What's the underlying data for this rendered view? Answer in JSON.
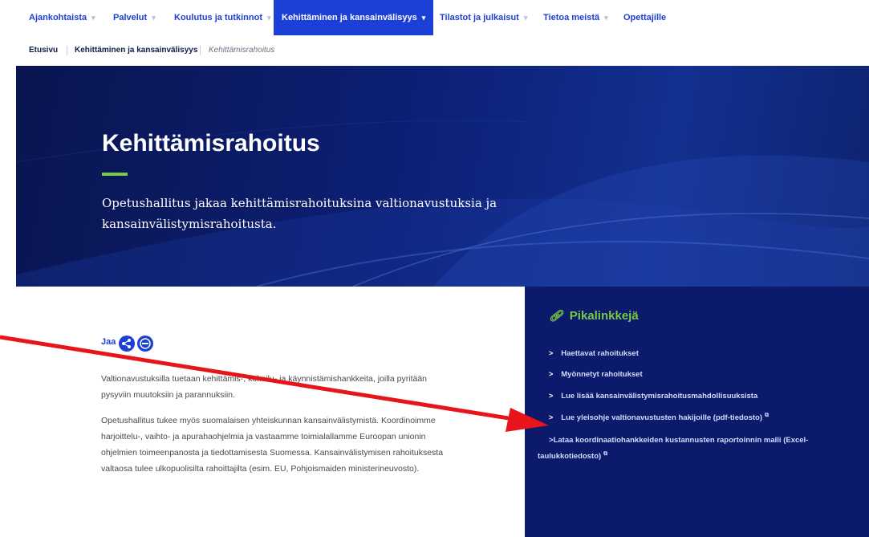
{
  "nav": {
    "items": [
      {
        "label": "Ajankohtaista"
      },
      {
        "label": "Palvelut"
      },
      {
        "label": "Koulutus ja tutkinnot"
      },
      {
        "label": "Kehittäminen ja kansainvälisyys",
        "active": true
      },
      {
        "label": "Tilastot ja julkaisut"
      },
      {
        "label": "Tietoa meistä"
      },
      {
        "label": "Opettajille"
      }
    ],
    "caret_icon": "chevron-down-icon"
  },
  "breadcrumb": {
    "items": [
      "Etusivu",
      "Kehittäminen ja kansainvälisyys",
      "Kehittämisrahoitus"
    ]
  },
  "hero": {
    "title": "Kehittämisrahoitus",
    "text": "Opetushallitus jakaa kehittämisrahoituksina valtionavustuksia ja kansainvälistymisrahoitusta."
  },
  "share": {
    "label": "Jaa",
    "icons": [
      "share-icon",
      "minus-circle-icon"
    ]
  },
  "article": {
    "p1": "Valtionavustuksilla tuetaan kehittämis-, kokeilu- ja käynnistämishankkeita, joilla pyritään pysyviin muutoksiin ja parannuksiin.",
    "p2": "Opetushallitus tukee myös suomalaisen yhteiskunnan kansainvälistymistä. Koordinoimme harjoittelu-, vaihto- ja apurahaohjelmia ja vastaamme toimialallamme Euroopan unionin ohjelmien toimeenpanosta ja tiedottamisesta Suomessa. Kansainvälistymisen rahoituksesta valtaosa tulee ulkopuolisilta rahoittajilta (esim. EU, Pohjoismaiden ministerineuvosto)."
  },
  "quicklinks": {
    "title": "Pikalinkkejä",
    "links": [
      {
        "label": "Haettavat rahoitukset"
      },
      {
        "label": "Myönnetyt rahoitukset"
      },
      {
        "label": "Lue lisää kansainvälistymisrahoitusmahdollisuuksista"
      },
      {
        "label": "Lue yleisohje valtionavustusten hakijoille (pdf-tiedosto)",
        "external": true
      },
      {
        "label": "Lataa koordinaatiohankkeiden kustannusten raportoinnin malli (Excel-taulukkotiedosto)",
        "external": true
      }
    ]
  },
  "colors": {
    "brand_blue": "#1c3fd6",
    "hero_navy": "#0b1a6b",
    "accent_green": "#7ac943",
    "annotation_red": "#e8141b"
  }
}
